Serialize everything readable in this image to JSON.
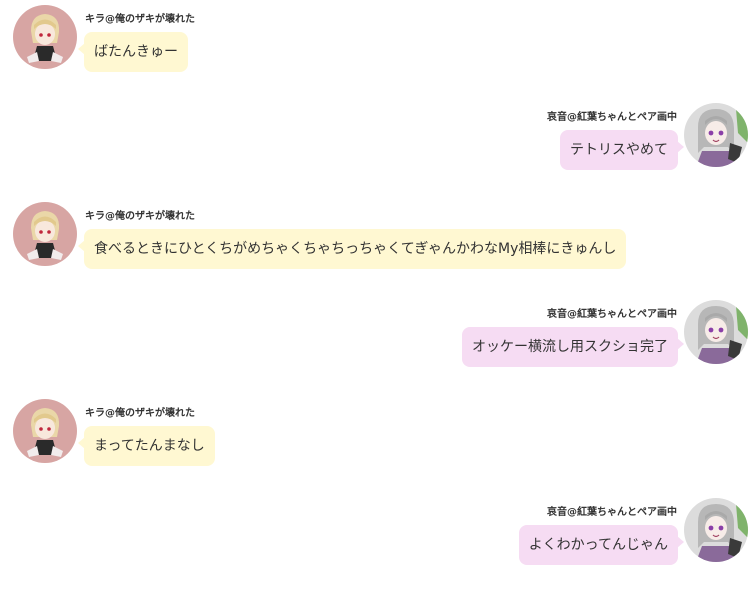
{
  "users": {
    "left": {
      "name": "キラ@俺のザキが壊れた",
      "avatar_icon": "blonde-character-avatar-icon",
      "bubble_color": "#fff8d2"
    },
    "right": {
      "name": "哀音@紅葉ちゃんとペア画中",
      "avatar_icon": "silver-hair-character-avatar-icon",
      "bubble_color": "#f6dcf3"
    }
  },
  "messages": [
    {
      "side": "left",
      "sender": "キラ@俺のザキが壊れた",
      "text": "ばたんきゅー"
    },
    {
      "side": "right",
      "sender": "哀音@紅葉ちゃんとペア画中",
      "text": "テトリスやめて"
    },
    {
      "side": "left",
      "sender": "キラ@俺のザキが壊れた",
      "text": "食べるときにひとくちがめちゃくちゃちっちゃくてぎゃんかわなMy相棒にきゅんし"
    },
    {
      "side": "right",
      "sender": "哀音@紅葉ちゃんとペア画中",
      "text": "オッケー横流し用スクショ完了"
    },
    {
      "side": "left",
      "sender": "キラ@俺のザキが壊れた",
      "text": "まってたんまなし"
    },
    {
      "side": "right",
      "sender": "哀音@紅葉ちゃんとペア画中",
      "text": "よくわかってんじゃん"
    }
  ]
}
